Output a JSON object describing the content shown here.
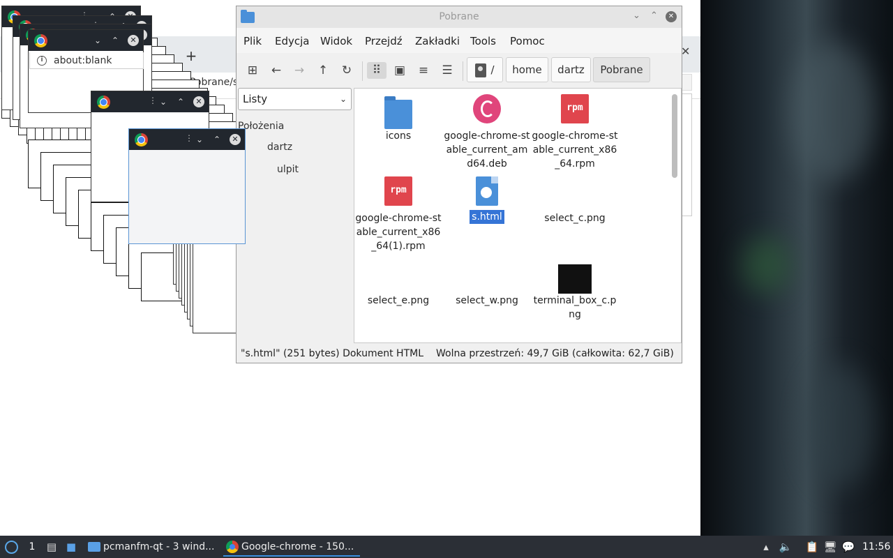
{
  "chrome_main": {
    "new_tab_glyph": "+",
    "partial_address": "Pobrane/s",
    "close_glyph": "✕"
  },
  "popup": {
    "address": "about:blank",
    "dots": "⋮",
    "min": "⌄",
    "max": "⌃",
    "close": "✕"
  },
  "file_manager": {
    "title": "Pobrane",
    "menu": [
      "Plik",
      "Edycja",
      "Widok",
      "Przejdź",
      "Zakładki",
      "Tools",
      "Pomoc"
    ],
    "breadcrumbs": [
      "/",
      "home",
      "dartz",
      "Pobrane"
    ],
    "side_pane_mode": "Listy",
    "side_header": "Położenia",
    "side_items": [
      "dartz",
      "ulpit"
    ],
    "files": [
      {
        "name": "icons",
        "type": "folder"
      },
      {
        "name": "google-chrome-stable_current_amd64.deb",
        "type": "deb"
      },
      {
        "name": "google-chrome-stable_current_x86_64.rpm",
        "type": "rpm"
      },
      {
        "name": "google-chrome-stable_current_x86_64(1).rpm",
        "type": "rpm"
      },
      {
        "name": "s.html",
        "type": "html",
        "selected": true
      },
      {
        "name": "select_c.png",
        "type": "png"
      },
      {
        "name": "select_e.png",
        "type": "png"
      },
      {
        "name": "select_w.png",
        "type": "png"
      },
      {
        "name": "terminal_box_c.png",
        "type": "png-black"
      }
    ],
    "rpm_label": "rpm",
    "status_left": "\"s.html\" (251 bytes) Dokument HTML",
    "status_right": "Wolna przestrzeń: 49,7 GiB (całkowita: 62,7 GiB)"
  },
  "taskbar": {
    "desktop_number": "1",
    "tasks": [
      {
        "label": "pcmanfm-qt - 3 wind...",
        "icon": "folder-icon",
        "active": false
      },
      {
        "label": "Google-chrome - 150...",
        "icon": "chrome-icon",
        "active": true
      }
    ],
    "clock": "11:56"
  },
  "colors": {
    "accent": "#3574d6",
    "titlebar_dark": "#22272e",
    "taskbar": "#2b2f36"
  }
}
